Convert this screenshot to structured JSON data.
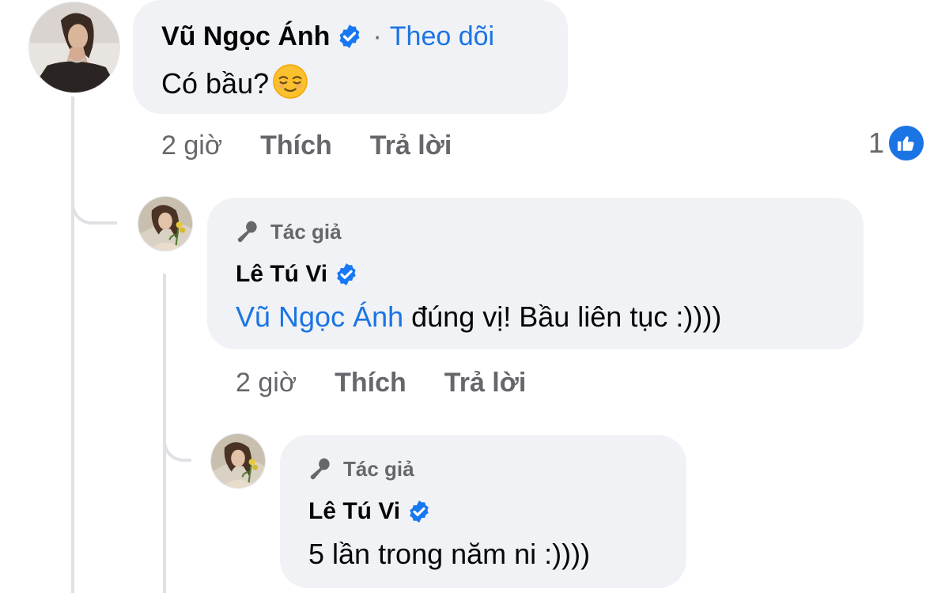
{
  "comment": {
    "author": "Vũ Ngọc Ánh",
    "follow_label": "Theo dõi",
    "separator": "·",
    "text": "Có bầu?",
    "emoji_icon": "relieved-face-emoji",
    "time": "2 giờ",
    "like_label": "Thích",
    "reply_label": "Trả lời",
    "reaction_count": "1",
    "reaction_icon": "like-icon"
  },
  "reply1": {
    "badge": "Tác giả",
    "author": "Lê Tú Vi",
    "mention": "Vũ Ngọc Ánh",
    "text": " đúng vị! Bầu liên tục :))))",
    "time": "2 giờ",
    "like_label": "Thích",
    "reply_label": "Trả lời"
  },
  "reply2": {
    "badge": "Tác giả",
    "author": "Lê Tú Vi",
    "text": "5 lần trong năm ni :))))"
  },
  "colors": {
    "link_blue": "#1b74e4",
    "verified_blue": "#1877f2",
    "bubble_bg": "#f0f2f5",
    "meta_gray": "#65676b"
  }
}
